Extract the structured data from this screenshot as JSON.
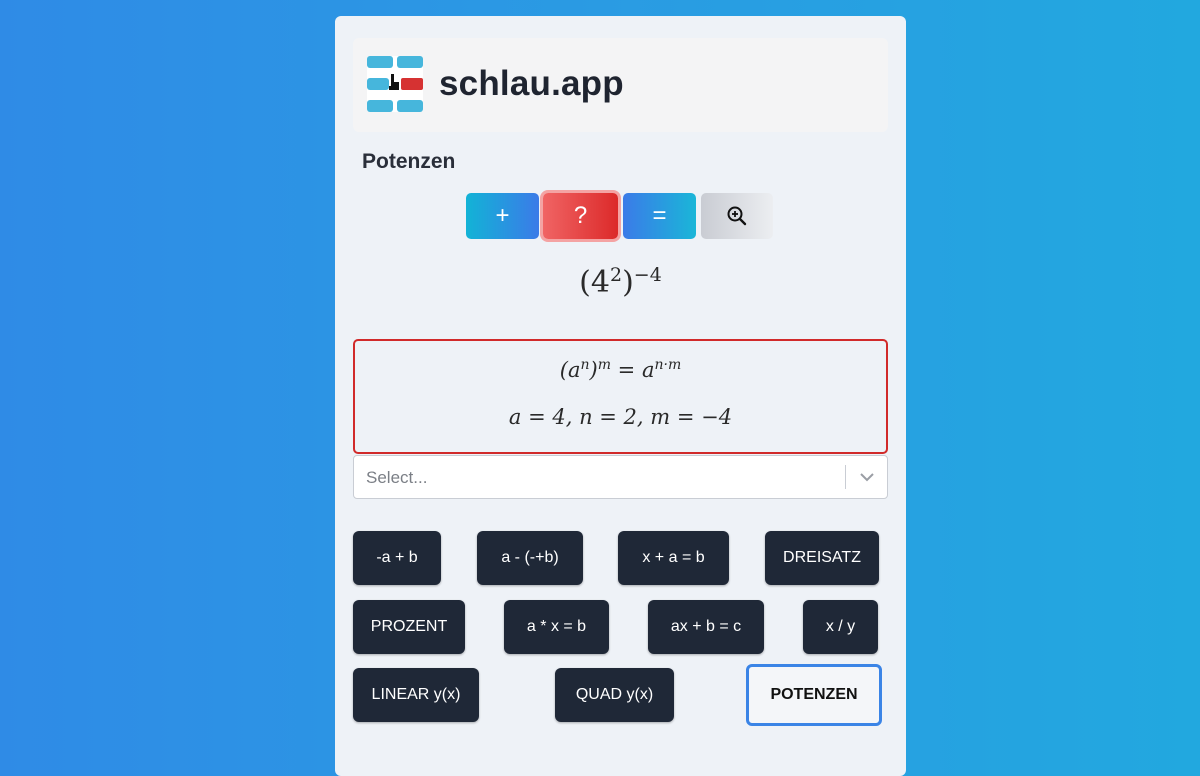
{
  "brand": {
    "name": "schlau.app"
  },
  "section": {
    "title": "Potenzen"
  },
  "toolbar": {
    "add": "+",
    "help": "?",
    "equals": "="
  },
  "problem": {
    "base": "4",
    "inner_exp": "2",
    "outer_exp": "−4"
  },
  "hint": {
    "rule_lhs_base": "a",
    "rule_lhs_n": "n",
    "rule_lhs_m": "m",
    "rule_rhs": "a",
    "rule_rhs_exp": "n·m",
    "values": "a = 4, n = 2, m = −4"
  },
  "select": {
    "placeholder": "Select..."
  },
  "quick": {
    "b1": "-a + b",
    "b2": "a - (-+b)",
    "b3": "x + a = b",
    "b4": "DREISATZ",
    "b5": "PROZENT",
    "b6": "a * x = b",
    "b7": "ax + b = c",
    "b8": "x / y",
    "b9": "LINEAR y(x)",
    "b10": "QUAD y(x)",
    "b11": "POTENZEN"
  },
  "colors": {
    "active_border": "#3a84e6",
    "hint_border": "#d12a2a",
    "button_dark": "#1f2837"
  }
}
